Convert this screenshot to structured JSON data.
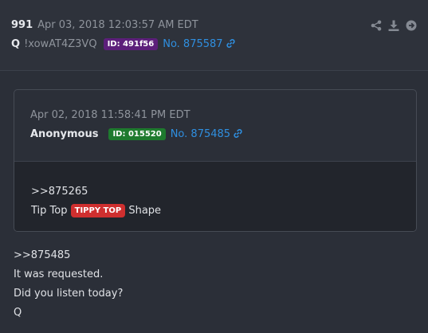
{
  "post": {
    "number": "991",
    "date": "Apr 03, 2018 12:03:57 AM EDT",
    "name": "Q",
    "tripcode": "!xowAT4Z3VQ",
    "id_badge": "ID: 491f56",
    "id_color": "#6a1b9a",
    "post_no": "No. 875587",
    "body": [
      ">>875485",
      "It was requested.",
      "Did you listen today?",
      "Q"
    ]
  },
  "actions": [
    "share-icon",
    "download-icon",
    "go-icon"
  ],
  "quoted": {
    "date": "Apr 02, 2018 11:58:41 PM EDT",
    "name": "Anonymous",
    "id_badge": "ID: 015520",
    "id_color": "#1e7a2e",
    "post_no": "No. 875485",
    "reply_ref": ">>875265",
    "text_before": "Tip Top",
    "tag": "TIPPY TOP",
    "text_after": "Shape"
  },
  "colors": {
    "link": "#2f8fe0",
    "tag": "#cf2f2f",
    "background": "#2b2f38"
  }
}
